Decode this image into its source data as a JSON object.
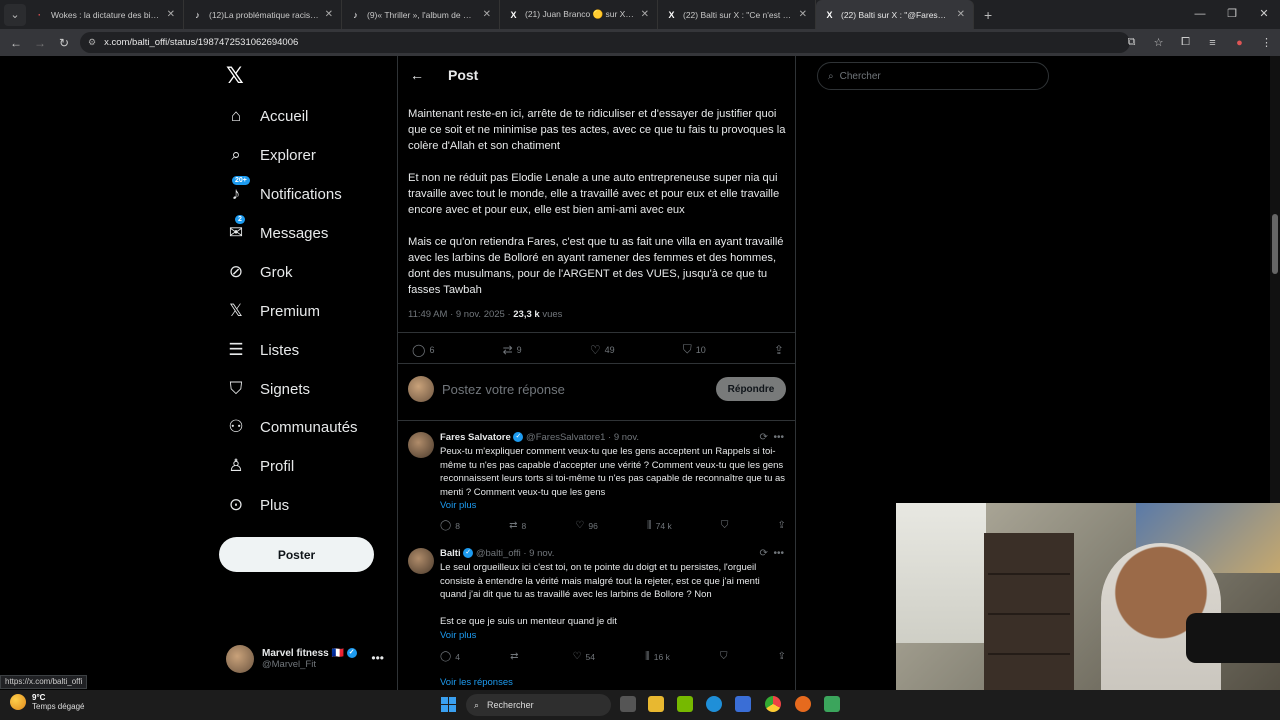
{
  "browser": {
    "tabs": [
      {
        "title": "Wokes : la dictature des bien-p",
        "icon": "generic-icon",
        "active": false
      },
      {
        "title": "(12)La problématique raciste d",
        "icon": "tiktok-icon",
        "active": false
      },
      {
        "title": "(9)« Thriller », l'album de Micha",
        "icon": "tiktok-icon",
        "active": false
      },
      {
        "title": "(21) Juan Branco 🟡 sur X : \"La",
        "icon": "x-icon",
        "active": false
      },
      {
        "title": "(22) Balti sur X : \"Ce n'est pas q",
        "icon": "x-icon",
        "active": false
      },
      {
        "title": "(22) Balti sur X : \"@FaresSalvato",
        "icon": "x-icon",
        "active": true
      }
    ],
    "url": "x.com/balti_offi/status/1987472531062694006",
    "status_link": "https://x.com/balti_offi"
  },
  "nav": {
    "items": [
      {
        "label": "Accueil",
        "icon": "home-icon",
        "glyph": "⌂"
      },
      {
        "label": "Explorer",
        "icon": "search-icon",
        "glyph": "⌕"
      },
      {
        "label": "Notifications",
        "icon": "bell-icon",
        "glyph": "♪",
        "badge": "20+"
      },
      {
        "label": "Messages",
        "icon": "envelope-icon",
        "glyph": "✉",
        "badge": "2"
      },
      {
        "label": "Grok",
        "icon": "grok-icon",
        "glyph": "⊘"
      },
      {
        "label": "Premium",
        "icon": "x-logo-icon",
        "glyph": "𝕏"
      },
      {
        "label": "Listes",
        "icon": "list-icon",
        "glyph": "☰"
      },
      {
        "label": "Signets",
        "icon": "bookmark-icon",
        "glyph": "⛉"
      },
      {
        "label": "Communautés",
        "icon": "communities-icon",
        "glyph": "⚇"
      },
      {
        "label": "Profil",
        "icon": "person-icon",
        "glyph": "♙"
      },
      {
        "label": "Plus",
        "icon": "more-circle-icon",
        "glyph": "⊙"
      }
    ],
    "post_button": "Poster",
    "account": {
      "name": "Marvel fitness 🇫🇷",
      "handle": "@Marvel_Fit"
    }
  },
  "post": {
    "header": "Post",
    "paragraphs": [
      "Maintenant reste-en ici, arrête de te ridiculiser et d'essayer de justifier quoi que ce soit et ne minimise pas tes actes, avec ce que tu fais tu provoques la colère d'Allah et son chatiment",
      "Et non ne réduit pas Elodie Lenale a une auto entrepreneuse super nia qui travaille avec tout le monde, elle a travaillé avec et pour eux et elle travaille encore avec et pour eux, elle est bien ami-ami avec eux",
      "Mais ce qu'on retiendra Fares, c'est que tu as fait une villa en ayant travaillé avec les larbins de Bolloré en ayant ramener des femmes et des hommes, dont des musulmans, pour de l'ARGENT et des VUES, jusqu'à ce que tu fasses Tawbah"
    ],
    "time": "11:49 AM · 9 nov. 2025 · ",
    "views_count": "23,3 k",
    "views_label": "vues",
    "stats": {
      "replies": "6",
      "reposts": "9",
      "likes": "49",
      "bookmarks": "10"
    },
    "reply_placeholder": "Postez votre réponse",
    "reply_button": "Répondre"
  },
  "replies": [
    {
      "name": "Fares Salvatore",
      "meta": "@FaresSalvatore1 · 9 nov.",
      "text": "Peux-tu m'expliquer comment veux-tu que les gens acceptent un Rappels si toi-même tu n'es pas capable d'accepter une vérité ? Comment veux-tu que les gens reconnaissent leurs torts si toi-même tu n'es pas capable de reconnaître que tu as menti ? Comment veux-tu que les gens",
      "more": "Voir plus",
      "stats": {
        "replies": "8",
        "reposts": "8",
        "likes": "96",
        "views": "74 k"
      }
    },
    {
      "name": "Balti",
      "meta": "@balti_offi · 9 nov.",
      "text": "Le seul orgueilleux ici c'est toi, on te pointe du doigt et tu persistes, l'orgueil consiste à entendre la vérité mais malgré tout la rejeter, est ce que j'ai menti quand j'ai dit que tu as travaillé avec les larbins de Bollore ? Non",
      "text2": "Est ce que je suis un menteur quand je dit",
      "more": "Voir plus",
      "stats": {
        "replies": "4",
        "reposts": "",
        "likes": "54",
        "views": "16 k"
      }
    }
  ],
  "see_replies": "Voir les réponses",
  "search": {
    "placeholder": "Chercher"
  },
  "taskbar": {
    "temp": "9°C",
    "weather": "Temps dégagé",
    "search": "Rechercher"
  },
  "colors": {
    "accent": "#1d9bf0",
    "background": "#000000",
    "text": "#e7e9ea",
    "muted": "#71767b"
  }
}
